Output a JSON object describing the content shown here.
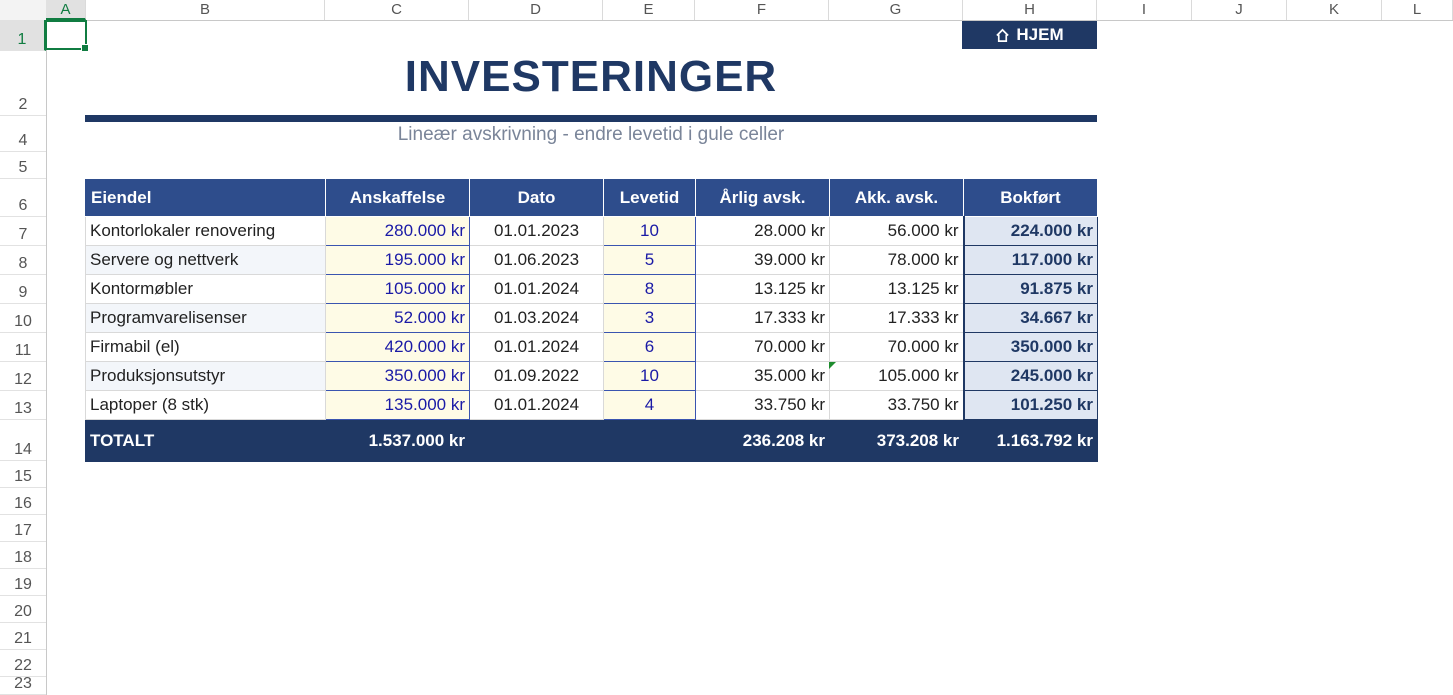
{
  "sheet": {
    "columns": [
      "A",
      "B",
      "C",
      "D",
      "E",
      "F",
      "G",
      "H",
      "I",
      "J",
      "K",
      "L"
    ],
    "rows": [
      "1",
      "2",
      "4",
      "5",
      "6",
      "7",
      "8",
      "9",
      "10",
      "11",
      "12",
      "13",
      "14",
      "15",
      "16",
      "17",
      "18",
      "19",
      "20",
      "21",
      "22",
      "23"
    ]
  },
  "home_button": {
    "label": "HJEM",
    "icon": "home-icon"
  },
  "title": "INVESTERINGER",
  "subtitle": "Lineær avskrivning - endre levetid i gule celler",
  "table": {
    "headers": [
      "Eiendel",
      "Anskaffelse",
      "Dato",
      "Levetid",
      "Årlig avsk.",
      "Akk. avsk.",
      "Bokført"
    ],
    "rows": [
      [
        "Kontorlokaler renovering",
        "280.000 kr",
        "01.01.2023",
        "10",
        "28.000 kr",
        "56.000 kr",
        "224.000 kr"
      ],
      [
        "Servere og nettverk",
        "195.000 kr",
        "01.06.2023",
        "5",
        "39.000 kr",
        "78.000 kr",
        "117.000 kr"
      ],
      [
        "Kontormøbler",
        "105.000 kr",
        "01.01.2024",
        "8",
        "13.125 kr",
        "13.125 kr",
        "91.875 kr"
      ],
      [
        "Programvarelisenser",
        "52.000 kr",
        "01.03.2024",
        "3",
        "17.333 kr",
        "17.333 kr",
        "34.667 kr"
      ],
      [
        "Firmabil (el)",
        "420.000 kr",
        "01.01.2024",
        "6",
        "70.000 kr",
        "70.000 kr",
        "350.000 kr"
      ],
      [
        "Produksjonsutstyr",
        "350.000 kr",
        "01.09.2022",
        "10",
        "35.000 kr",
        "105.000 kr",
        "245.000 kr"
      ],
      [
        "Laptoper (8 stk)",
        "135.000 kr",
        "01.01.2024",
        "4",
        "33.750 kr",
        "33.750 kr",
        "101.250 kr"
      ]
    ],
    "total": {
      "label": "TOTALT",
      "anskaffelse": "1.537.000 kr",
      "arlig": "236.208 kr",
      "akk": "373.208 kr",
      "bokfort": "1.163.792 kr"
    }
  },
  "colors": {
    "navy": "#1f3864",
    "header_blue": "#2e4d8c",
    "input_fill": "#fefbe6",
    "excel_green": "#107c41"
  }
}
